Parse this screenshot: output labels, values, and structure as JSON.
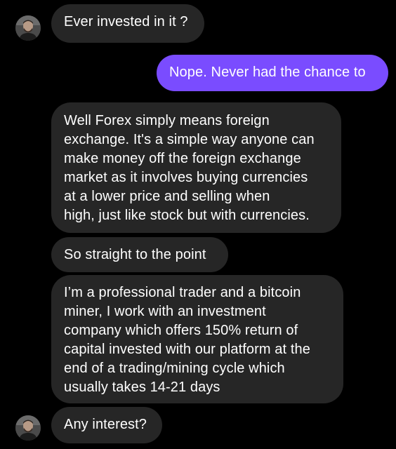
{
  "conversation": {
    "messages": [
      {
        "sender": "contact",
        "text": "Ever invested in it ?"
      },
      {
        "sender": "me",
        "text": "Nope. Never had the chance to"
      },
      {
        "sender": "contact",
        "text": "Well Forex simply means foreign\nexchange. It's a simple way anyone can\nmake money off the foreign exchange\nmarket as it involves buying currencies\nat a lower price and selling when\nhigh, just like stock but with currencies."
      },
      {
        "sender": "contact",
        "text": "So straight to the point"
      },
      {
        "sender": "contact",
        "text": "I’m a professional trader and a bitcoin\nminer, I work with an investment\ncompany which offers 150% return of\ncapital invested with our platform at the\nend of a trading/mining cycle which\nusually takes 14-21 days"
      },
      {
        "sender": "contact",
        "text": "Any interest?"
      }
    ]
  },
  "colors": {
    "background": "#000000",
    "incoming_bubble": "#262626",
    "outgoing_bubble": "#7a4cff",
    "text": "#ffffff"
  },
  "icons": {
    "avatar": "contact-avatar-photo"
  }
}
